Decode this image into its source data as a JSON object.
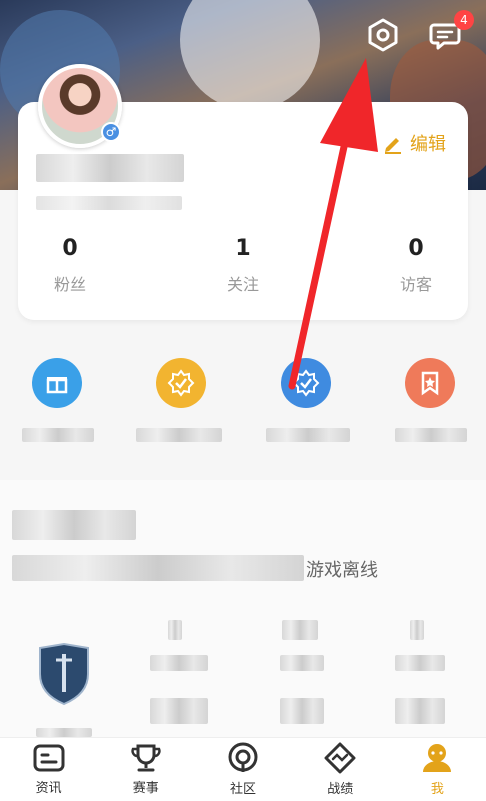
{
  "header": {
    "settings_icon": "hexagon-settings-icon",
    "message_icon": "chat-bubble-icon",
    "message_badge": "4"
  },
  "profile": {
    "edit_label": "编辑",
    "stats": [
      {
        "value": "0",
        "label": "粉丝"
      },
      {
        "value": "1",
        "label": "关注"
      },
      {
        "value": "0",
        "label": "访客"
      }
    ]
  },
  "game": {
    "status_text": "游戏离线"
  },
  "tabbar": {
    "items": [
      {
        "label": "资讯",
        "icon": "news-icon"
      },
      {
        "label": "赛事",
        "icon": "trophy-icon"
      },
      {
        "label": "社区",
        "icon": "community-icon"
      },
      {
        "label": "战绩",
        "icon": "record-icon"
      },
      {
        "label": "我",
        "icon": "me-icon"
      }
    ]
  },
  "colors": {
    "accent": "#e3a31a",
    "arrow": "#f0262a",
    "badge": "#ff4444"
  }
}
